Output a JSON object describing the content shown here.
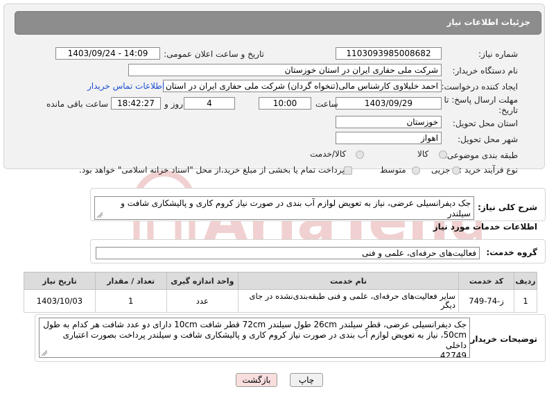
{
  "header": {
    "title": "جزئیات اطلاعات نیاز"
  },
  "fields": {
    "need_number_label": "شماره نیاز:",
    "need_number": "1103093985008682",
    "announce_label": "تاریخ و ساعت اعلان عمومی:",
    "announce_value": "1403/09/24 - 14:09",
    "buyer_org_label": "نام دستگاه خریدار:",
    "buyer_org": "شرکت ملی حفاری ایران در استان خوزستان",
    "requester_label": "ایجاد کننده درخواست:",
    "requester": "احمد خلیلاوی کارشناس مالی(تنخواه گردان) شرکت ملی حفاری ایران در استان",
    "contact_link": "اطلاعات تماس خریدار",
    "deadline_label_1": "مهلت ارسال پاسخ: تا",
    "deadline_label_2": "تاریخ:",
    "deadline_date": "1403/09/29",
    "time_label": "ساعت",
    "deadline_time": "10:00",
    "days_value": "4",
    "days_label": "روز و",
    "remaining_time": "18:42:27",
    "remaining_label": "ساعت باقی مانده",
    "province_label": "استان محل تحویل:",
    "province": "خوزستان",
    "city_label": "شهر محل تحویل:",
    "city": "اهواز",
    "category_label": "طبقه بندی موضوعی:",
    "category_options": [
      "کالا",
      "کالا/خدمت"
    ],
    "purchase_type_label": "نوع فرآیند خرید :",
    "purchase_options": [
      "جزیی",
      "متوسط"
    ],
    "payment_note": "پرداخت تمام یا بخشی از مبلغ خرید،از محل \"اسناد خزانه اسلامی\" خواهد بود."
  },
  "summary": {
    "label": "شرح کلی نیاز:",
    "text": "جک دیفرانسیلی عرضی، نیاز به تعویض لوازم آب بندی در صورت نیاز کروم کاری و پالیشکاری شافت و سیلندر"
  },
  "services": {
    "heading": "اطلاعات خدمات مورد نیاز",
    "group_label": "گروه خدمت:",
    "group_value": "فعالیت‌های حرفه‌ای، علمی و فنی",
    "columns": [
      "ردیف",
      "کد خدمت",
      "نام خدمت",
      "واحد اندازه گیری",
      "تعداد / مقدار",
      "تاریخ نیاز"
    ],
    "rows": [
      {
        "row": "1",
        "code": "ز-74-749",
        "name": "سایر فعالیت‌های حرفه‌ای، علمی و فنی طبقه‌بندی‌نشده در جای دیگر",
        "unit": "عدد",
        "qty": "1",
        "date": "1403/10/03"
      }
    ]
  },
  "buyer_notes": {
    "label": "توضیحات خریدار:",
    "line1": "جک دیفرانسیلی عرضی، قطر سیلندر 26cm طول سیلندر 72cm قطر شافت 10cm دارای دو عدد شافت هر کدام به طول",
    "line2": "50cm، نیاز به تعویض لوازم آب بندی در صورت نیاز کروم کاری و پالیشکاری شافت و سیلندر پرداخت بصورت اعتباری داخلی",
    "line3": "42749"
  },
  "buttons": {
    "print": "چاپ",
    "back": "بازگشت"
  },
  "watermark": {
    "text": "AriaTender.net"
  },
  "colors": {
    "header_bg": "#8d8d8d",
    "link": "#1a4fd0",
    "back_btn": "#f9dede",
    "watermark": "#c0302c"
  }
}
